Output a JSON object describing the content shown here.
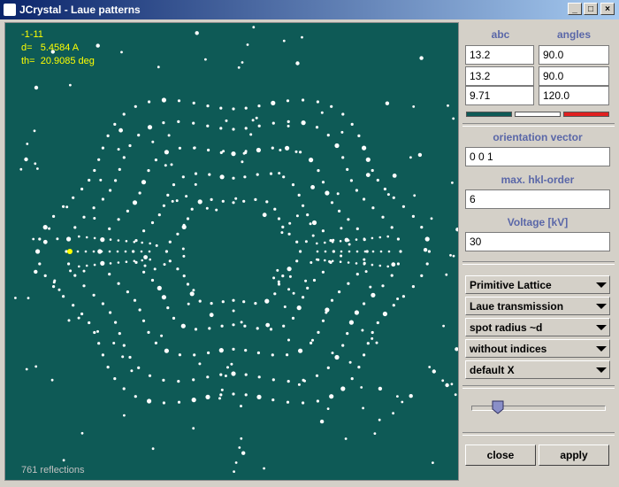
{
  "window": {
    "title": "JCrystal - Laue patterns"
  },
  "pattern": {
    "hkl": "-1-11",
    "d_line": "d=   5.4584 A",
    "th_line": "th=  20.9085 deg",
    "reflections_text": "761 reflections"
  },
  "lattice": {
    "abc_label": "abc",
    "angles_label": "angles",
    "a": "13.2",
    "b": "13.2",
    "c": "9.71",
    "alpha": "90.0",
    "beta": "90.0",
    "gamma": "120.0",
    "colors": [
      "#0e5a56",
      "#ffffff",
      "#e02020"
    ]
  },
  "orientation": {
    "label": "orientation vector",
    "value": "0 0 1"
  },
  "hkl_order": {
    "label": "max. hkl-order",
    "value": "6"
  },
  "voltage": {
    "label": "Voltage [kV]",
    "value": "30"
  },
  "dropdowns": {
    "lattice_type": "Primitive Lattice",
    "mode": "Laue transmission",
    "spot_radius": "spot radius ~d",
    "indices": "without indices",
    "axis": "default X"
  },
  "slider": {
    "level": 0.2
  },
  "buttons": {
    "close": "close",
    "apply": "apply"
  },
  "colors": {
    "canvas_bg": "#0e5a56",
    "spot": "#ffffff",
    "highlight": "#ffff00",
    "header_text": "#5a67a8"
  }
}
